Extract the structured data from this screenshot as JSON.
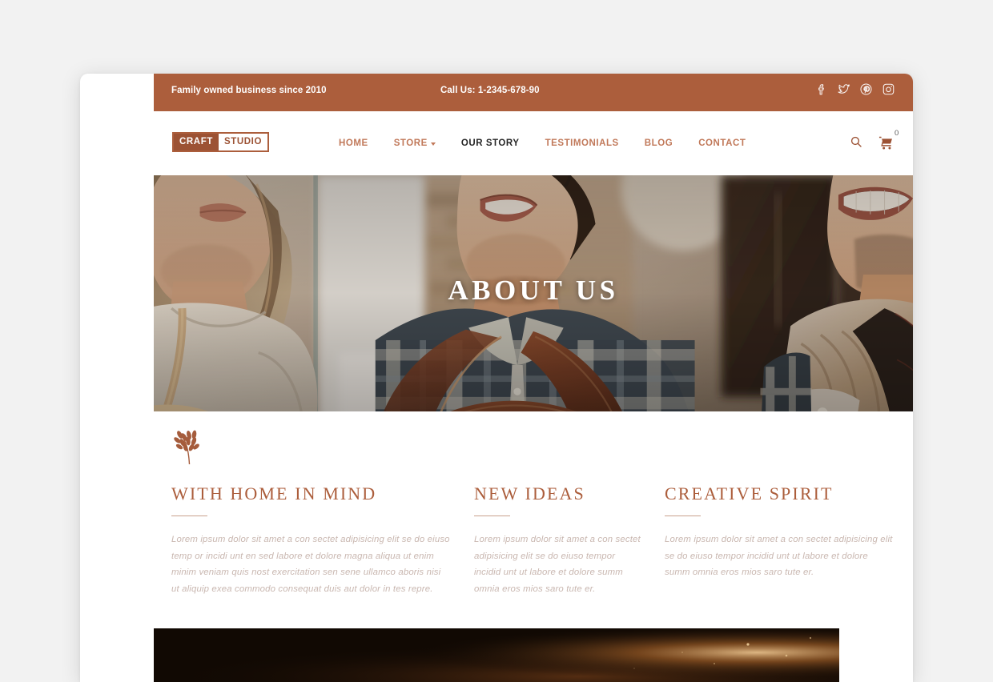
{
  "topbar": {
    "tagline": "Family owned business since 2010",
    "phone": "Call Us: 1-2345-678-90",
    "background_color": "#ac5e3c",
    "social": [
      {
        "name": "facebook-icon",
        "label": "Facebook"
      },
      {
        "name": "twitter-icon",
        "label": "Twitter"
      },
      {
        "name": "pinterest-icon",
        "label": "Pinterest"
      },
      {
        "name": "instagram-icon",
        "label": "Instagram"
      }
    ]
  },
  "header": {
    "logo": {
      "part1": "CRAFT",
      "part2": "STUDIO"
    },
    "nav": [
      {
        "label": "HOME",
        "active": false,
        "dropdown": false
      },
      {
        "label": "STORE",
        "active": false,
        "dropdown": true
      },
      {
        "label": "OUR STORY",
        "active": true,
        "dropdown": false
      },
      {
        "label": "TESTIMONIALS",
        "active": false,
        "dropdown": false
      },
      {
        "label": "BLOG",
        "active": false,
        "dropdown": false
      },
      {
        "label": "CONTACT",
        "active": false,
        "dropdown": false
      }
    ],
    "search_icon": "search-icon",
    "cart_icon": "shopping-cart-icon",
    "cart_count": "0",
    "accent_color": "#c1795a",
    "active_color": "#262626"
  },
  "hero": {
    "title": "ABOUT US",
    "image_alt": "Three smiling craftspeople wearing aprons in a workshop"
  },
  "content": {
    "ornament": "wheat-branch-ornament",
    "heading_color": "#ac5e3c",
    "columns": [
      {
        "heading": "WITH HOME IN MIND",
        "body": "Lorem ipsum dolor sit amet a con sectet adipisicing elit se do eiuso temp or incidi unt en sed labore et dolore magna aliqua ut enim minim veniam quis nost exercitation sen sene ullamco aboris nisi ut aliquip exea commodo consequat duis aut dolor in tes repre."
      },
      {
        "heading": "NEW IDEAS",
        "body": "Lorem ipsum dolor sit amet a con sectet adipisicing elit se do eiuso tempor incidid unt ut labore et dolore summ omnia eros mios saro tute er."
      },
      {
        "heading": "CREATIVE SPIRIT",
        "body": "Lorem ipsum dolor sit amet a con sectet adipisicing elit se do eiuso tempor incidid unt ut labore et dolore summ omnia eros mios saro tute er."
      }
    ]
  },
  "bottom_section": {
    "image_alt": "Dark warm-toned workshop sparks image"
  }
}
